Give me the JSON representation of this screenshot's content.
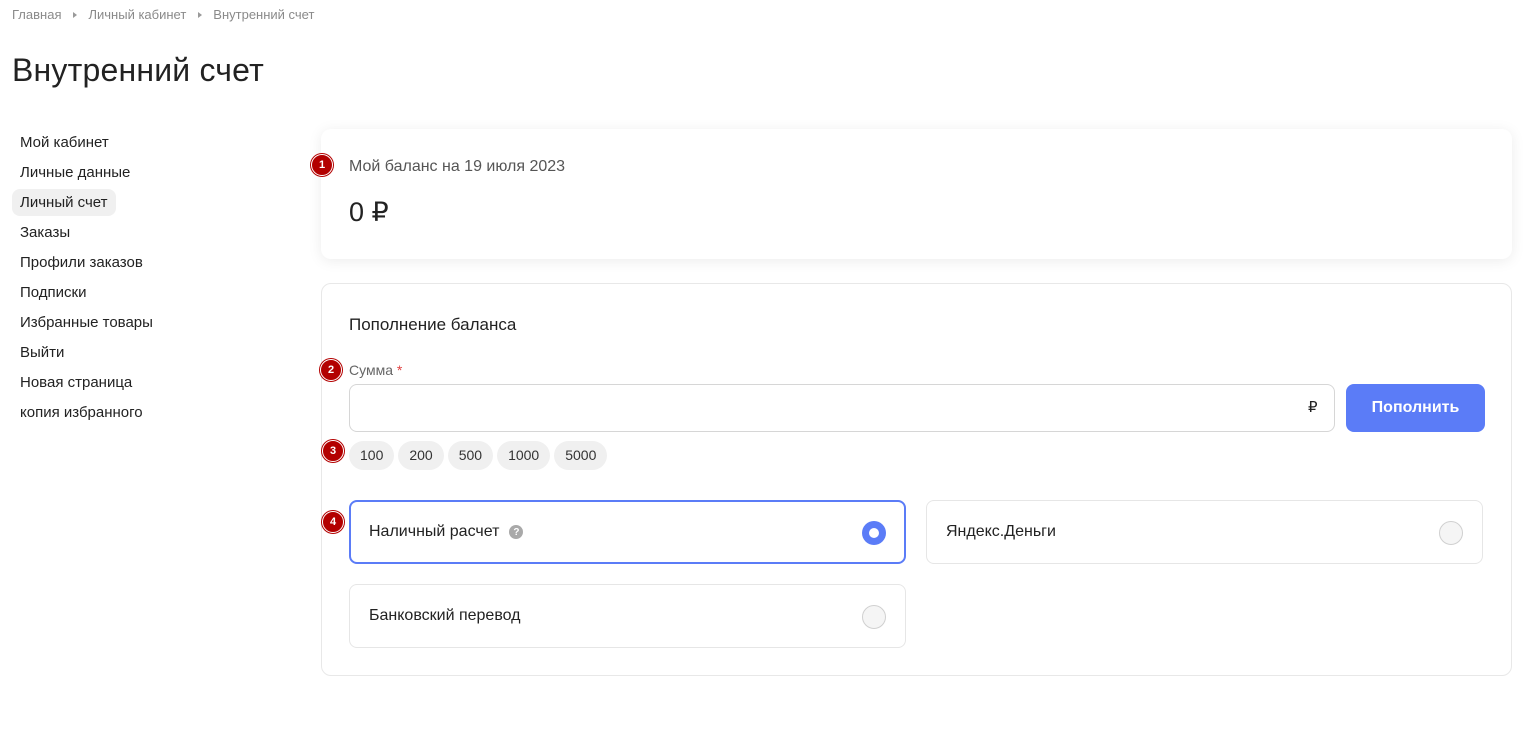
{
  "breadcrumb": [
    "Главная",
    "Личный кабинет",
    "Внутренний счет"
  ],
  "page_title": "Внутренний счет",
  "sidebar": {
    "items": [
      {
        "label": "Мой кабинет",
        "active": false
      },
      {
        "label": "Личные данные",
        "active": false
      },
      {
        "label": "Личный счет",
        "active": true
      },
      {
        "label": "Заказы",
        "active": false
      },
      {
        "label": "Профили заказов",
        "active": false
      },
      {
        "label": "Подписки",
        "active": false
      },
      {
        "label": "Избранные товары",
        "active": false
      },
      {
        "label": "Выйти",
        "active": false
      },
      {
        "label": "Новая страница",
        "active": false
      },
      {
        "label": "копия избранного",
        "active": false
      }
    ]
  },
  "markers": [
    "1",
    "2",
    "3",
    "4"
  ],
  "balance": {
    "label": "Мой баланс на 19 июля 2023",
    "amount": "0 ₽"
  },
  "topup": {
    "title": "Пополнение баланса",
    "amount_label": "Сумма",
    "required_mark": "*",
    "amount_value": "",
    "currency": "₽",
    "button_label": "Пополнить",
    "quick_amounts": [
      "100",
      "200",
      "500",
      "1000",
      "5000"
    ],
    "payment_methods": [
      {
        "label": "Наличный расчет",
        "selected": true,
        "help_icon": "question-icon"
      },
      {
        "label": "Яндекс.Деньги",
        "selected": false
      },
      {
        "label": "Банковский перевод",
        "selected": false
      }
    ]
  },
  "colors": {
    "accent": "#5b7cf7",
    "marker": "#b30000",
    "active_bg": "#f0f0f0"
  }
}
